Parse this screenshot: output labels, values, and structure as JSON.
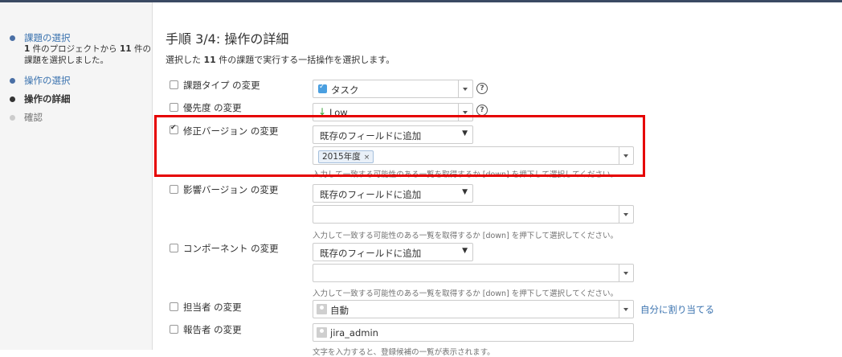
{
  "sidebar": {
    "steps": [
      {
        "label": "課題の選択",
        "sub_prefix": "1",
        "sub_middle": " 件のプロジェクトから ",
        "sub_count": "11",
        "sub_suffix": " 件の課題を選択しました。",
        "state": "link"
      },
      {
        "label": "操作の選択",
        "state": "link"
      },
      {
        "label": "操作の詳細",
        "state": "current"
      },
      {
        "label": "確認",
        "state": "pending"
      }
    ]
  },
  "main": {
    "title": "手順 3/4: 操作の詳細",
    "desc_prefix": "選択した ",
    "desc_count": "11",
    "desc_suffix": " 件の課題で実行する一括操作を選択します。"
  },
  "fields": {
    "issue_type": {
      "label": "課題タイプ の変更",
      "checked": false,
      "value": "タスク",
      "icon": "task-checkbox-icon"
    },
    "priority": {
      "label": "優先度 の変更",
      "checked": false,
      "value": "Low",
      "icon": "priority-low-arrow-icon"
    },
    "fix_version": {
      "label": "修正バージョン の変更",
      "checked": true,
      "mode": "既存のフィールドに追加",
      "tags": [
        "2015年度"
      ],
      "hint": "入力して一致する可能性のある一覧を取得するか [down] を押下して選択してください。"
    },
    "affects_version": {
      "label": "影響バージョン の変更",
      "checked": false,
      "mode": "既存のフィールドに追加",
      "hint": "入力して一致する可能性のある一覧を取得するか [down] を押下して選択してください。"
    },
    "components": {
      "label": "コンポーネント の変更",
      "checked": false,
      "mode": "既存のフィールドに追加",
      "hint": "入力して一致する可能性のある一覧を取得するか [down] を押下して選択してください。"
    },
    "assignee": {
      "label": "担当者 の変更",
      "checked": false,
      "value": "自動",
      "assign_to_me": "自分に割り当てる"
    },
    "reporter": {
      "label": "報告者 の変更",
      "checked": false,
      "value": "jira_admin",
      "hint": "文字を入力すると、登録候補の一覧が表示されます。"
    }
  },
  "colors": {
    "highlight": "#e60000",
    "link": "#3b73af",
    "sidebar_bg": "#f5f5f5"
  }
}
